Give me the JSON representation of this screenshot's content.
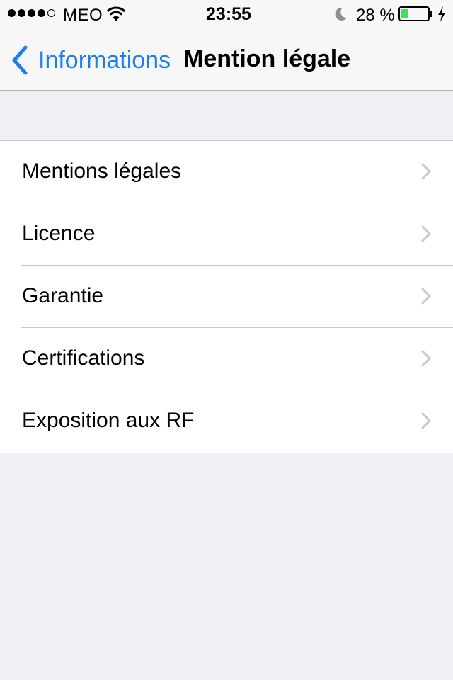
{
  "status_bar": {
    "carrier": "MEO",
    "time": "23:55",
    "battery_percent": "28 %",
    "battery_level": 0.28,
    "signal_bars_filled": 4,
    "signal_bars_total": 5,
    "icons": [
      "wifi-icon",
      "moon-icon",
      "battery-icon",
      "charging-bolt-icon"
    ]
  },
  "nav": {
    "back_label": "Informations",
    "title": "Mention légale"
  },
  "colors": {
    "accent": "#1a7df5",
    "background": "#efeff4",
    "battery_fill": "#4cd964"
  },
  "rows": [
    {
      "label": "Mentions légales"
    },
    {
      "label": "Licence"
    },
    {
      "label": "Garantie"
    },
    {
      "label": "Certifications"
    },
    {
      "label": "Exposition aux RF"
    }
  ]
}
